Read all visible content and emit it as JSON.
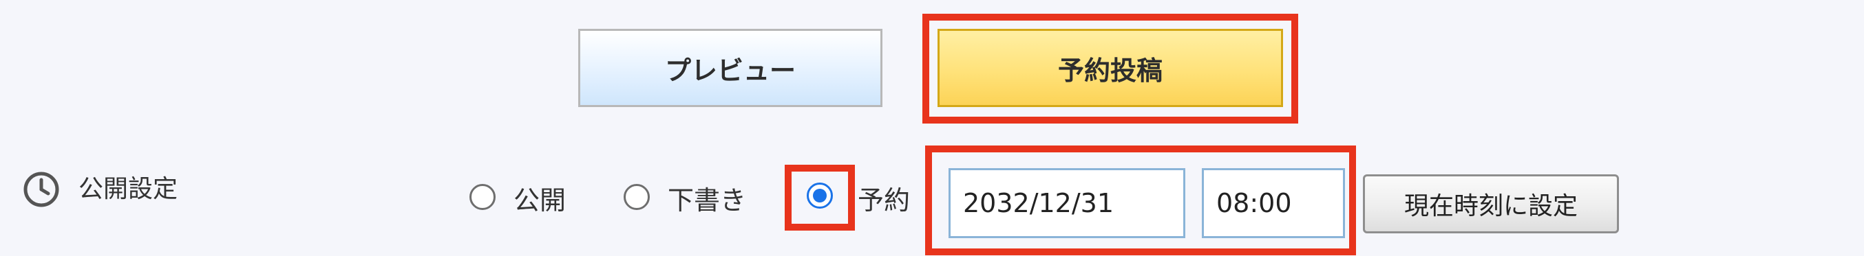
{
  "buttons": {
    "preview_label": "プレビュー",
    "schedule_post_label": "予約投稿",
    "set_current_time_label": "現在時刻に設定"
  },
  "publish_settings": {
    "label": "公開設定",
    "icon": "clock-icon",
    "options": [
      {
        "label": "公開",
        "checked": false
      },
      {
        "label": "下書き",
        "checked": false
      },
      {
        "label": "予約",
        "checked": true
      }
    ],
    "date_value": "2032/12/31",
    "time_value": "08:00"
  },
  "colors": {
    "highlight": "#e8341c",
    "radio_checked": "#1a73e8",
    "schedule_button": "#ffe27a",
    "preview_button": "#d8ecff",
    "background": "#f5f6fb"
  }
}
